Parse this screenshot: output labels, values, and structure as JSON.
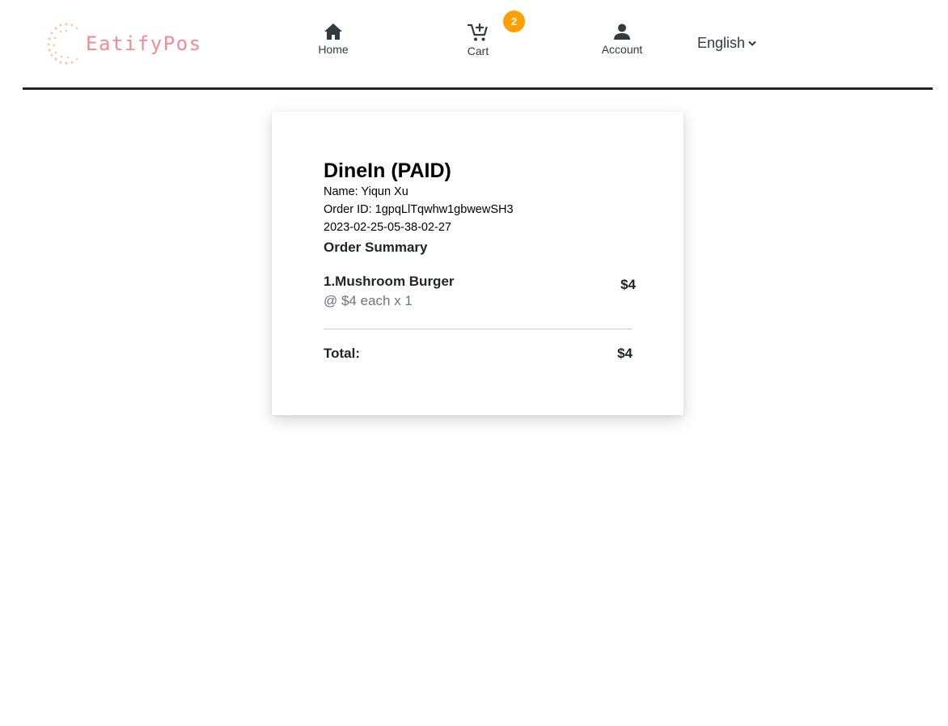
{
  "brand": {
    "name": "EatifyPos",
    "accent_color": "#f08c92",
    "dots_color": "#f8c9a8"
  },
  "nav": {
    "home_label": "Home",
    "home_icon": "home-icon",
    "cart_label": "Cart",
    "cart_icon": "cart-icon",
    "cart_count": "2",
    "badge_color": "#ffa000",
    "account_label": "Account",
    "account_icon": "account-icon",
    "language": "English"
  },
  "order": {
    "title": "DineIn (PAID)",
    "name_line": "Name: Yiqun Xu",
    "id_line": "Order ID: 1gpqLlTqwhw1gbwewSH3",
    "timestamp": "2023-02-25-05-38-02-27",
    "summary_label": "Order Summary",
    "items": [
      {
        "name": "1.Mushroom Burger",
        "detail": "@ $4 each x 1",
        "price": "$4"
      }
    ],
    "total_label": "Total:",
    "total_value": "$4"
  }
}
